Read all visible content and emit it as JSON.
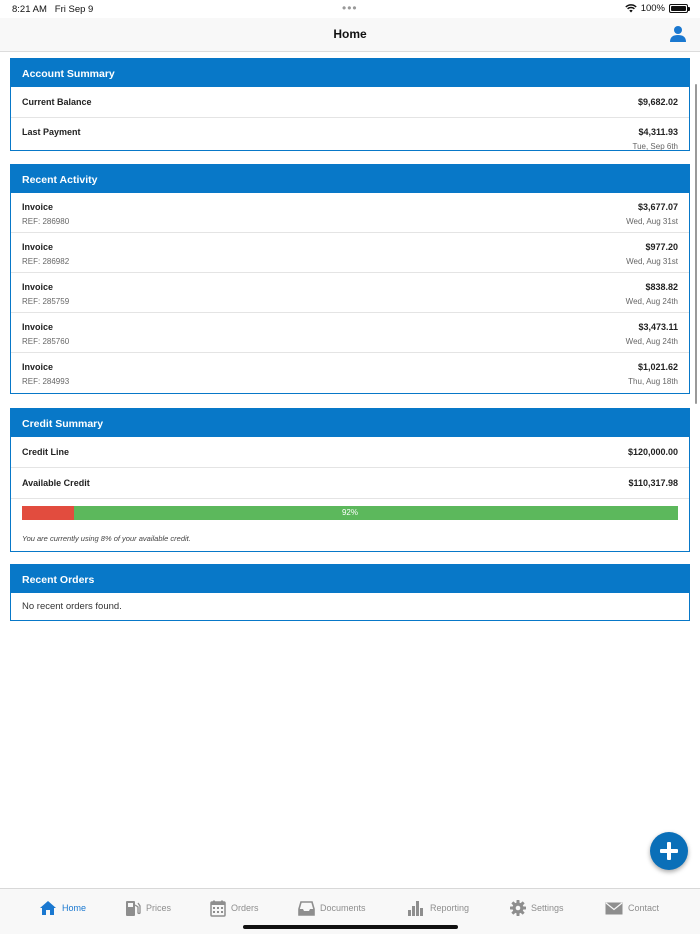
{
  "status_bar": {
    "time": "8:21 AM",
    "date": "Fri Sep 9",
    "battery": "100%"
  },
  "nav": {
    "title": "Home"
  },
  "account_summary": {
    "title": "Account Summary",
    "current_balance_label": "Current Balance",
    "current_balance": "$9,682.02",
    "last_payment_label": "Last Payment",
    "last_payment": "$4,311.93",
    "last_payment_date": "Tue, Sep 6th"
  },
  "recent_activity": {
    "title": "Recent Activity",
    "items": [
      {
        "type": "Invoice",
        "ref": "REF: 286980",
        "amount": "$3,677.07",
        "date": "Wed, Aug 31st"
      },
      {
        "type": "Invoice",
        "ref": "REF: 286982",
        "amount": "$977.20",
        "date": "Wed, Aug 31st"
      },
      {
        "type": "Invoice",
        "ref": "REF: 285759",
        "amount": "$838.82",
        "date": "Wed, Aug 24th"
      },
      {
        "type": "Invoice",
        "ref": "REF: 285760",
        "amount": "$3,473.11",
        "date": "Wed, Aug 24th"
      },
      {
        "type": "Invoice",
        "ref": "REF: 284993",
        "amount": "$1,021.62",
        "date": "Thu, Aug 18th"
      }
    ]
  },
  "credit_summary": {
    "title": "Credit Summary",
    "credit_line_label": "Credit Line",
    "credit_line": "$120,000.00",
    "available_credit_label": "Available Credit",
    "available_credit": "$110,317.98",
    "available_percent_label": "92%",
    "used_fraction": 0.08,
    "note": "You are currently using 8% of your available credit."
  },
  "recent_orders": {
    "title": "Recent Orders",
    "empty_message": "No recent orders found."
  },
  "tabs": [
    {
      "label": "Home",
      "icon": "home-icon",
      "active": true
    },
    {
      "label": "Prices",
      "icon": "fuel-pump-icon",
      "active": false
    },
    {
      "label": "Orders",
      "icon": "calendar-icon",
      "active": false
    },
    {
      "label": "Documents",
      "icon": "inbox-icon",
      "active": false
    },
    {
      "label": "Reporting",
      "icon": "bar-chart-icon",
      "active": false
    },
    {
      "label": "Settings",
      "icon": "gear-icon",
      "active": false
    },
    {
      "label": "Contact",
      "icon": "envelope-icon",
      "active": false
    }
  ],
  "colors": {
    "accent": "#0878c8",
    "used": "#e24c3e",
    "available": "#5cb85c",
    "tab_active": "#1a78d0",
    "tab_inactive": "#8e8e8e"
  }
}
